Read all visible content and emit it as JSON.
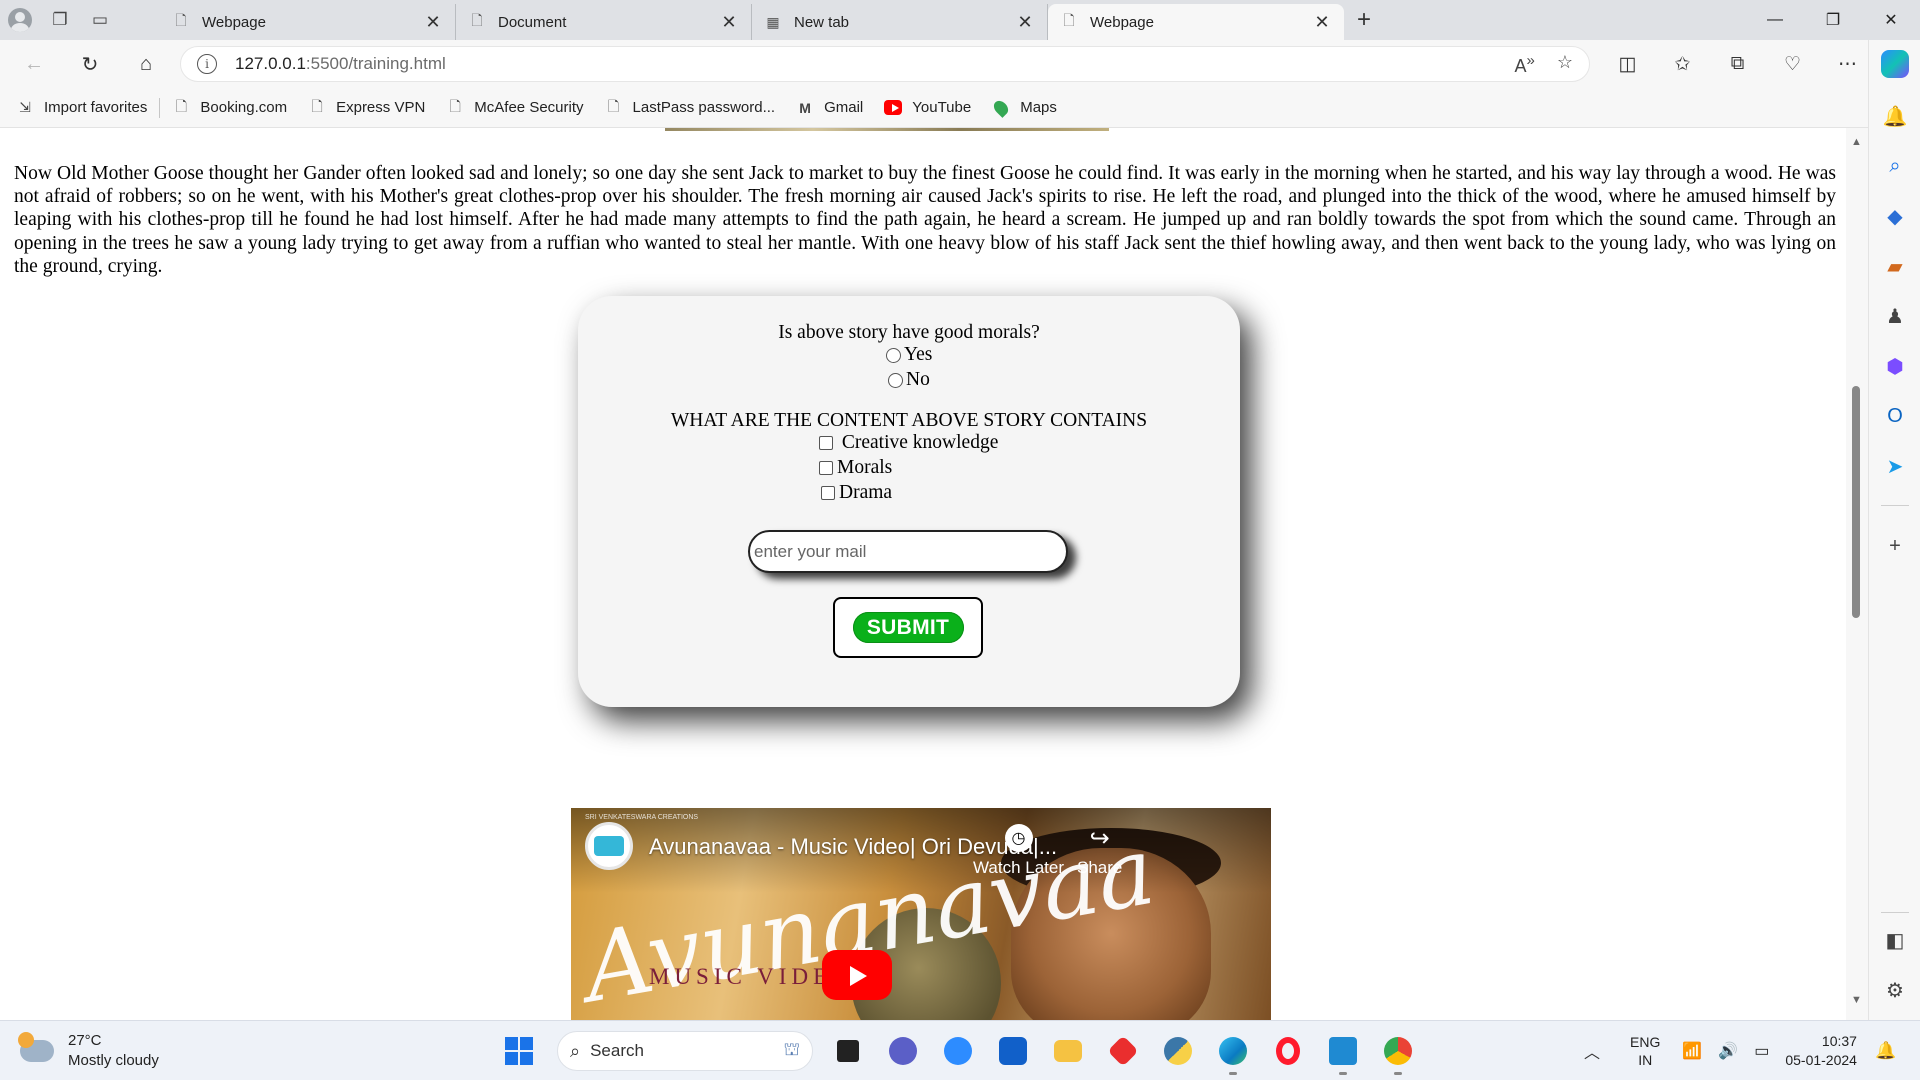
{
  "browser": {
    "tabs": [
      {
        "label": "Webpage",
        "icon": "page-icon",
        "active": false
      },
      {
        "label": "Document",
        "icon": "page-icon",
        "active": false
      },
      {
        "label": "New tab",
        "icon": "newtab-icon",
        "active": false
      },
      {
        "label": "Webpage",
        "icon": "page-icon",
        "active": true
      }
    ],
    "url_host": "127.0.0.1",
    "url_rest": ":5500/training.html",
    "favorites": [
      {
        "label": "Import favorites",
        "icon": "import-icon"
      },
      {
        "label": "Booking.com",
        "icon": "page-icon"
      },
      {
        "label": "Express VPN",
        "icon": "page-icon"
      },
      {
        "label": "McAfee Security",
        "icon": "page-icon"
      },
      {
        "label": "LastPass password...",
        "icon": "page-icon"
      },
      {
        "label": "Gmail",
        "icon": "gmail-icon"
      },
      {
        "label": "YouTube",
        "icon": "youtube-icon"
      },
      {
        "label": "Maps",
        "icon": "maps-icon"
      }
    ]
  },
  "page": {
    "story": "Now Old Mother Goose thought her Gander often looked sad and lonely; so one day she sent Jack to market to buy the finest Goose he could find. It was early in the morning when he started, and his way lay through a wood. He was not afraid of robbers; so on he went, with his Mother's great clothes-prop over his shoulder. The fresh morning air caused Jack's spirits to rise. He left the road, and plunged into the thick of the wood, where he amused himself by leaping with his clothes-prop till he found he had lost himself. After he had made many attempts to find the path again, he heard a scream. He jumped up and ran boldly towards the spot from which the sound came. Through an opening in the trees he saw a young lady trying to get away from a ruffian who wanted to steal her mantle. With one heavy blow of his staff Jack sent the thief howling away, and then went back to the young lady, who was lying on the ground, crying.",
    "quiz": {
      "question1": "Is above story have good morals?",
      "radio_options": [
        "Yes",
        "No"
      ],
      "question2": "WHAT ARE THE CONTENT ABOVE STORY CONTAINS",
      "checkbox_options": [
        " Creative knowledge",
        "Morals",
        "Drama"
      ],
      "email_placeholder": "enter your mail",
      "submit_label": "SUBMIT"
    },
    "video": {
      "title": "Avunanavaa - Music Video| Ori Devuda|...",
      "watch_later": "Watch Later",
      "share": "Share",
      "overlay_script": "Avunanavaa",
      "overlay_caption": "MUSIC VIDEO",
      "mini_credit": "SRI VENKATESWARA CREATIONS"
    }
  },
  "taskbar": {
    "weather_temp": "27°C",
    "weather_desc": "Mostly cloudy",
    "search_label": "Search",
    "lang_line1": "ENG",
    "lang_line2": "IN",
    "time": "10:37",
    "date": "05-01-2024"
  },
  "colors": {
    "submit_green": "#0ab01a",
    "youtube_red": "#ff0000",
    "accent_blue": "#1a73e8"
  }
}
